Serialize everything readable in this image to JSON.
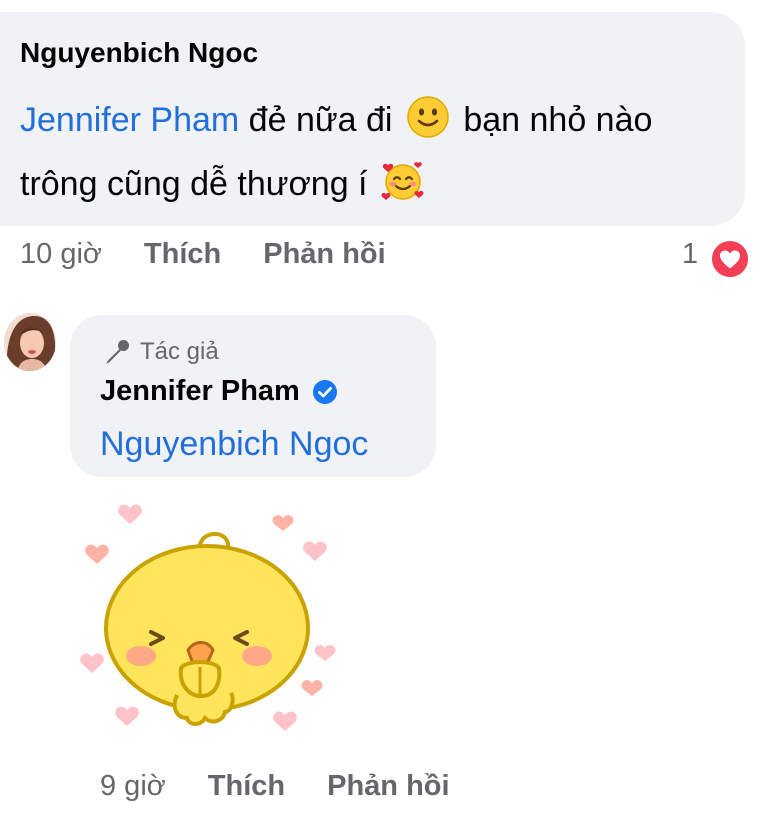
{
  "comment1": {
    "author": "Nguyenbich Ngoc",
    "mention": "Jennifer Pham",
    "text_part1": " đẻ nữa đi ",
    "text_part2": " bạn nhỏ nào trông cũng dễ thương í ",
    "emoji1": "slightly-smiling-face",
    "emoji2": "smiling-face-with-hearts",
    "time": "10 giờ",
    "like_label": "Thích",
    "reply_label": "Phản hồi",
    "reaction_count": "1",
    "reaction_type": "love"
  },
  "comment2": {
    "author_badge": "Tác giả",
    "author": "Jennifer Pham",
    "verified": true,
    "mention": "Nguyenbich Ngoc",
    "sticker": "yellow-chick-with-hearts",
    "time": "9 giờ",
    "like_label": "Thích",
    "reply_label": "Phản hồi"
  },
  "colors": {
    "mention": "#216fdb",
    "bubble": "#f0f2f5",
    "meta": "#65676b",
    "love": "#f33e58",
    "verified": "#1877f2"
  }
}
